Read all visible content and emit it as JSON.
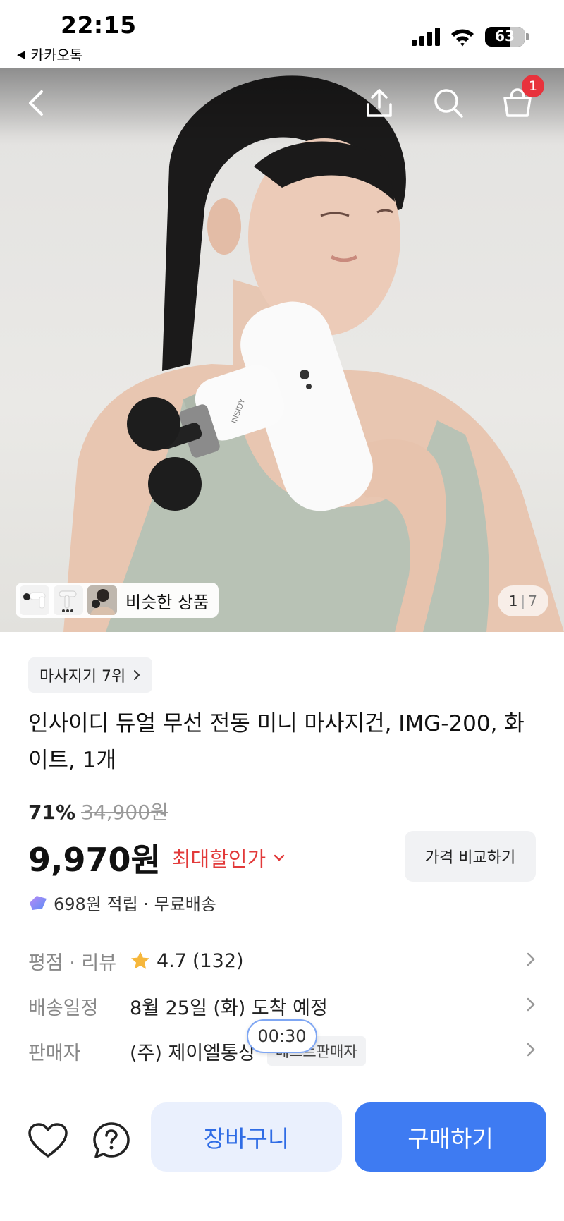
{
  "status_bar": {
    "time": "22:15",
    "back_app": "카카오톡",
    "battery": "63",
    "battery_level_percent": 63
  },
  "header": {
    "cart_badge": "1"
  },
  "gallery": {
    "similar_label": "비슷한 상품",
    "page_current": "1",
    "page_separator": "|",
    "page_total": "7",
    "device_brand": "INSIDY"
  },
  "product": {
    "rank_chip": "마사지기 7위",
    "title": "인사이디 듀얼 무선 전동 미니 마사지건, IMG-200, 화이트, 1개",
    "discount_percent": "71%",
    "original_price": "34,900원",
    "price": "9,970원",
    "max_discount_label": "최대할인가",
    "compare_button": "가격 비교하기",
    "reward_text": "698원 적립 · 무료배송"
  },
  "info_rows": {
    "rating_label": "평점 · 리뷰",
    "rating_value": "4.7",
    "rating_count": "(132)",
    "delivery_label": "배송일정",
    "delivery_value": "8월 25일 (화) 도착 예정",
    "seller_label": "판매자",
    "seller_value": "(주) 제이엘통상",
    "seller_badge": "베스트판매자"
  },
  "timer": "00:30",
  "bottom_bar": {
    "cart_button": "장바구니",
    "buy_button": "구매하기"
  },
  "colors": {
    "accent_blue": "#3e7bf2",
    "cart_bg": "#eaf0fd",
    "discount_red": "#e23a3a",
    "badge_red": "#e8323c",
    "star": "#f6b73c"
  }
}
